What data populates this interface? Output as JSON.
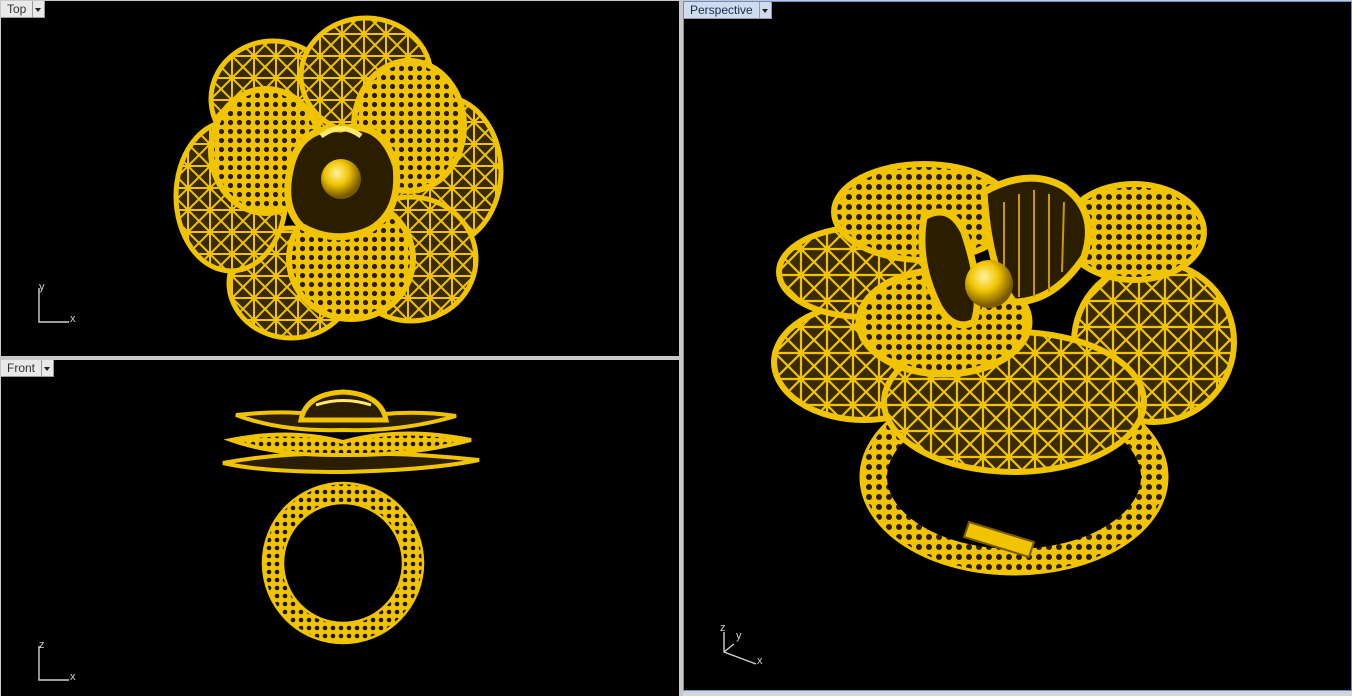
{
  "viewports": {
    "top": {
      "label": "Top",
      "axis_a": "y",
      "axis_b": "x"
    },
    "front": {
      "label": "Front",
      "axis_a": "z",
      "axis_b": "x"
    },
    "persp": {
      "label": "Perspective",
      "axis_z": "z",
      "axis_y": "y",
      "axis_x": "x"
    }
  },
  "colors": {
    "viewport_bg": "#000000",
    "model_gold": "#f0c400",
    "model_dark": "#7a5a00",
    "model_highlight": "#ffe86a",
    "active_label_bg": "#cfdcef"
  },
  "icons": [
    "dropdown-arrow-icon",
    "axis-widget-icon"
  ]
}
